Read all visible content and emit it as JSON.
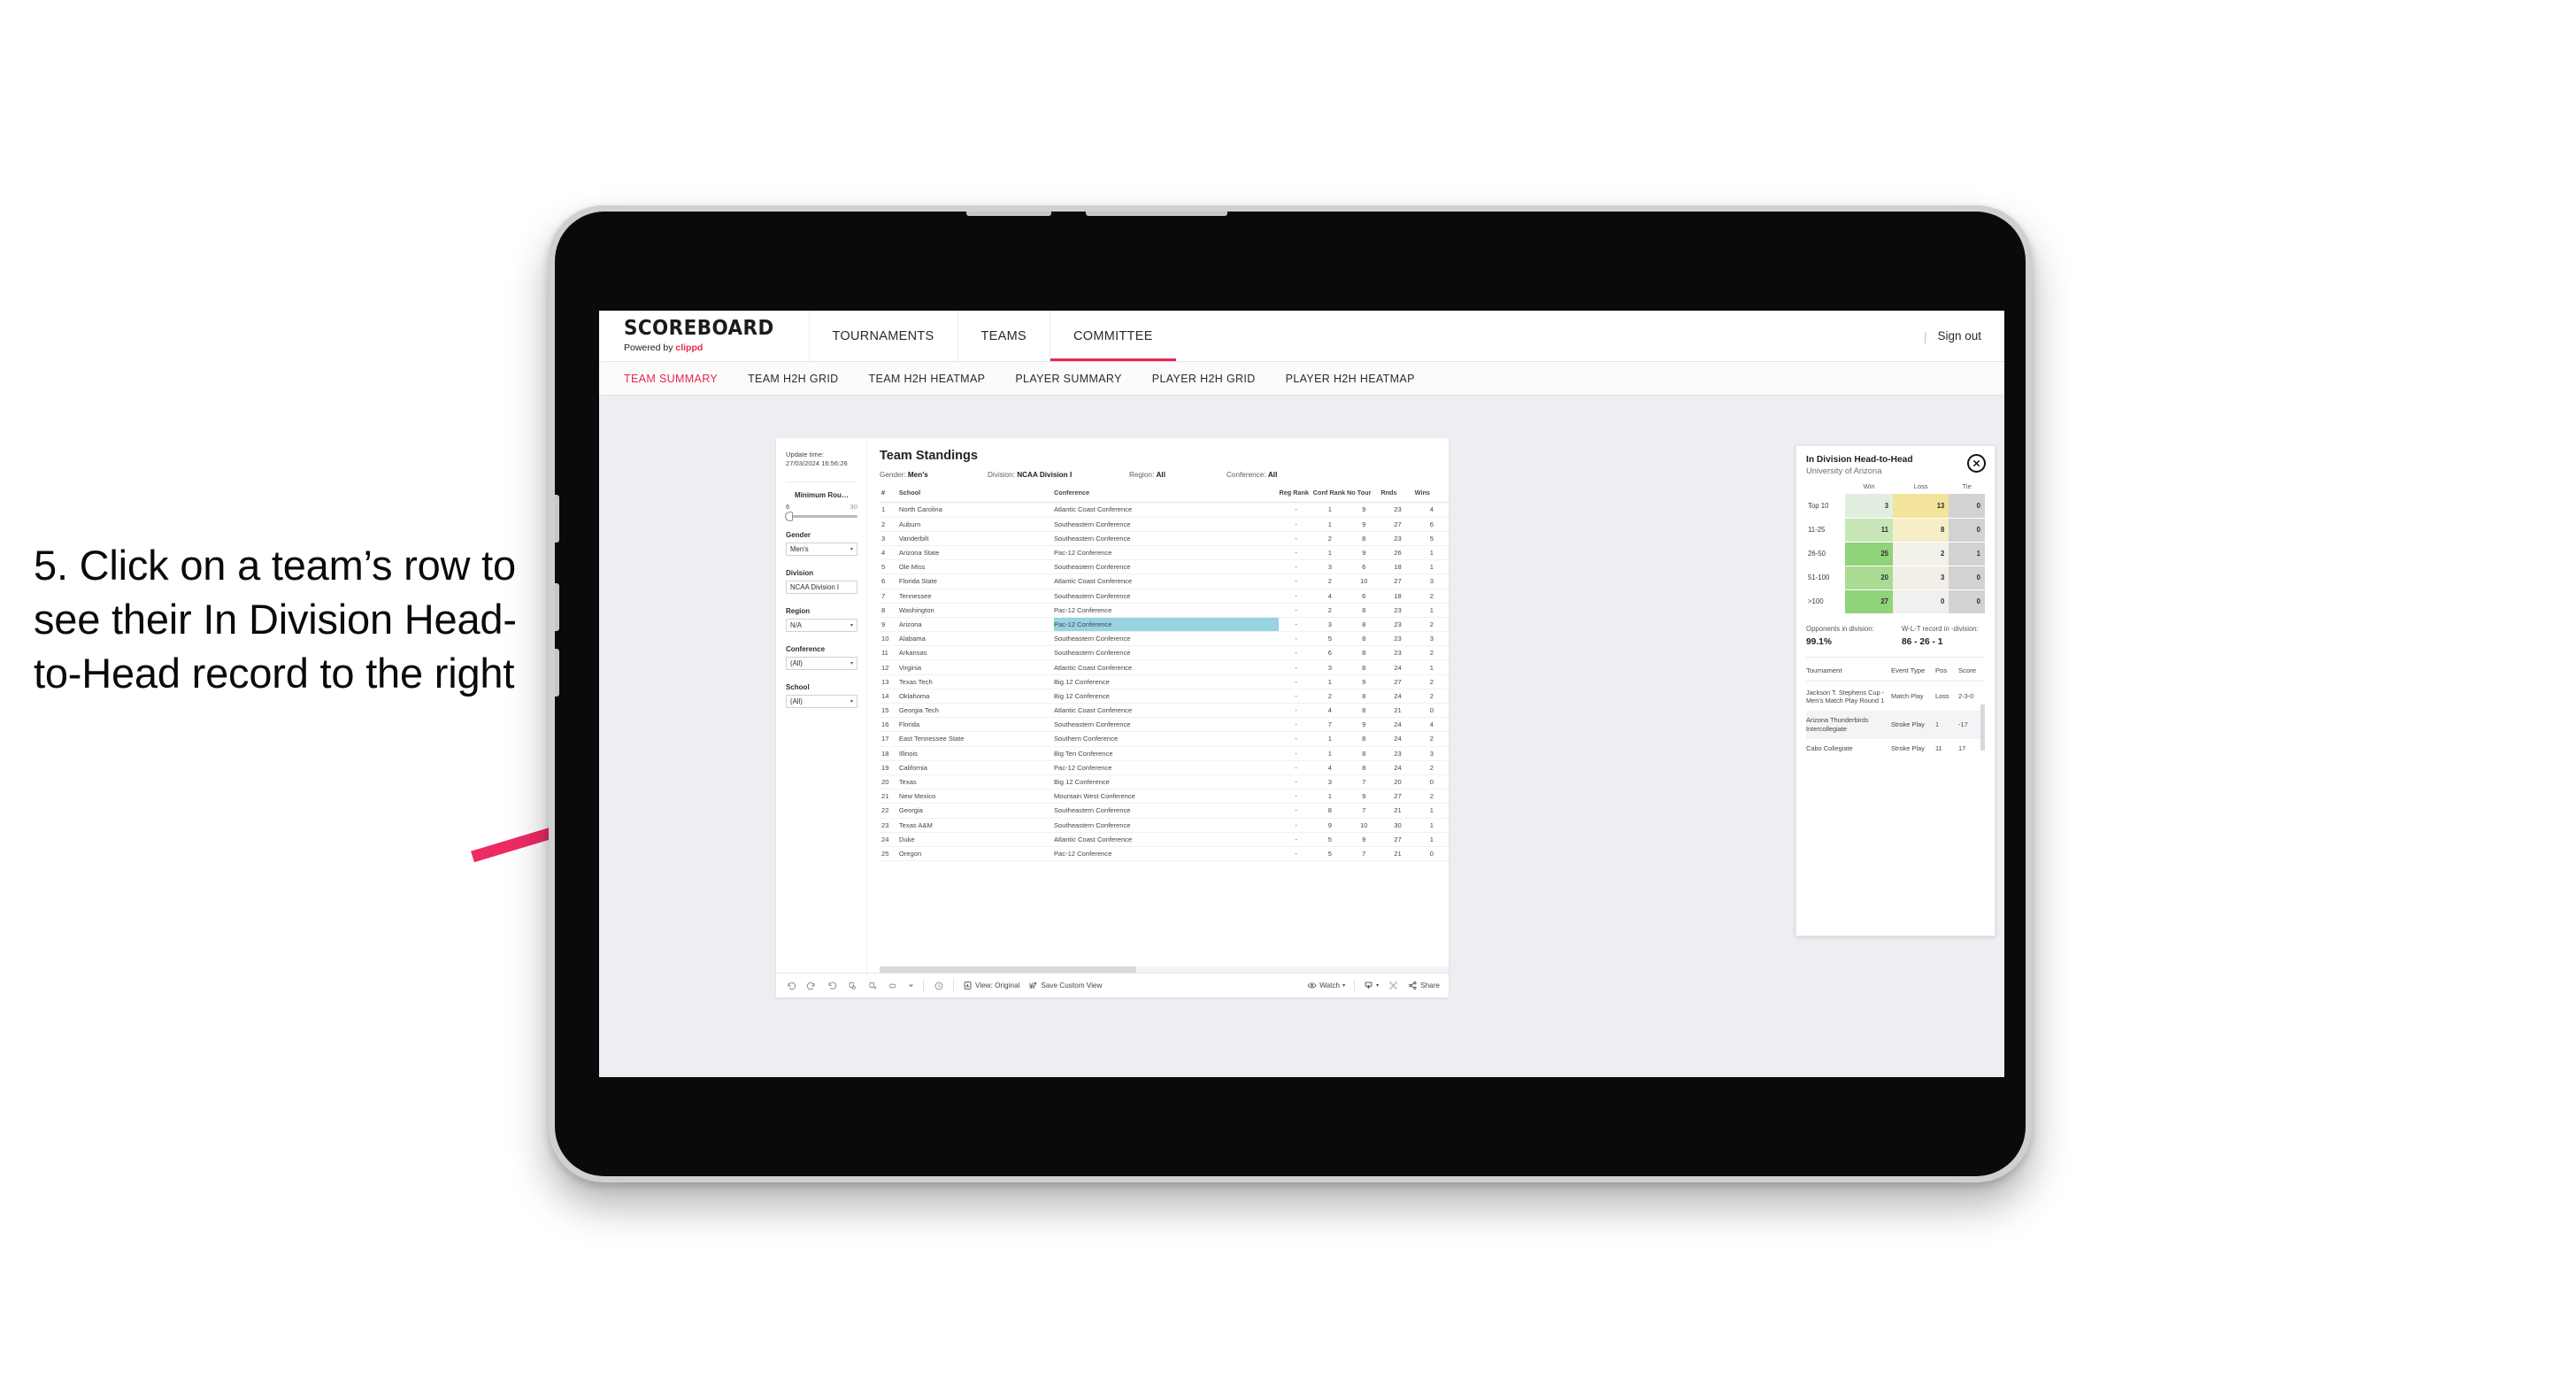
{
  "annotation": {
    "text": "5. Click on a team’s row to see their In Division Head-to-Head record to the right",
    "arrow_color": "#ee2a63"
  },
  "app": {
    "brand": {
      "title": "SCOREBOARD",
      "powered_prefix": "Powered by ",
      "powered_name": "clippd"
    },
    "top_nav": [
      {
        "label": "TOURNAMENTS",
        "active": false
      },
      {
        "label": "TEAMS",
        "active": false
      },
      {
        "label": "COMMITTEE",
        "active": true
      }
    ],
    "sign_out": "Sign out",
    "divider": "|",
    "sub_nav": [
      {
        "label": "TEAM SUMMARY",
        "active": true
      },
      {
        "label": "TEAM H2H GRID",
        "active": false
      },
      {
        "label": "TEAM H2H HEATMAP",
        "active": false
      },
      {
        "label": "PLAYER SUMMARY",
        "active": false
      },
      {
        "label": "PLAYER H2H GRID",
        "active": false
      },
      {
        "label": "PLAYER H2H HEATMAP",
        "active": false
      }
    ],
    "accent": "#e8264f"
  },
  "filters": {
    "update_time_label": "Update time:",
    "update_time_value": "27/03/2024 16:56:26",
    "min_rounds": {
      "label": "Minimum Rou…",
      "min": "6",
      "max": "30"
    },
    "gender": {
      "label": "Gender",
      "value": "Men’s"
    },
    "division": {
      "label": "Division",
      "value": "NCAA Division I"
    },
    "region": {
      "label": "Region",
      "value": "N/A"
    },
    "conference": {
      "label": "Conference",
      "value": "(All)"
    },
    "school": {
      "label": "School",
      "value": "(All)"
    },
    "caret": "▾"
  },
  "standings": {
    "title": "Team Standings",
    "meta": [
      {
        "label": "Gender: ",
        "value": "Men’s"
      },
      {
        "label": "Division: ",
        "value": "NCAA Division I"
      },
      {
        "label": "Region: ",
        "value": "All"
      },
      {
        "label": "Conference: ",
        "value": "All"
      }
    ],
    "columns": [
      "#",
      "School",
      "Conference",
      "Reg Rank",
      "Conf Rank",
      "No Tour",
      "Rnds",
      "Wins"
    ],
    "highlight_color": "#98d3e0",
    "highlighted_row_rank": "9",
    "rows": [
      {
        "rank": "1",
        "school": "North Carolina",
        "conference": "Atlantic Coast Conference",
        "reg_rank": "-",
        "conf_rank": "1",
        "no_tour": "9",
        "rnds": "23",
        "wins": "4"
      },
      {
        "rank": "2",
        "school": "Auburn",
        "conference": "Southeastern Conference",
        "reg_rank": "-",
        "conf_rank": "1",
        "no_tour": "9",
        "rnds": "27",
        "wins": "6"
      },
      {
        "rank": "3",
        "school": "Vanderbilt",
        "conference": "Southeastern Conference",
        "reg_rank": "-",
        "conf_rank": "2",
        "no_tour": "8",
        "rnds": "23",
        "wins": "5"
      },
      {
        "rank": "4",
        "school": "Arizona State",
        "conference": "Pac-12 Conference",
        "reg_rank": "-",
        "conf_rank": "1",
        "no_tour": "9",
        "rnds": "26",
        "wins": "1"
      },
      {
        "rank": "5",
        "school": "Ole Miss",
        "conference": "Southeastern Conference",
        "reg_rank": "-",
        "conf_rank": "3",
        "no_tour": "6",
        "rnds": "18",
        "wins": "1"
      },
      {
        "rank": "6",
        "school": "Florida State",
        "conference": "Atlantic Coast Conference",
        "reg_rank": "-",
        "conf_rank": "2",
        "no_tour": "10",
        "rnds": "27",
        "wins": "3"
      },
      {
        "rank": "7",
        "school": "Tennessee",
        "conference": "Southeastern Conference",
        "reg_rank": "-",
        "conf_rank": "4",
        "no_tour": "6",
        "rnds": "18",
        "wins": "2"
      },
      {
        "rank": "8",
        "school": "Washington",
        "conference": "Pac-12 Conference",
        "reg_rank": "-",
        "conf_rank": "2",
        "no_tour": "8",
        "rnds": "23",
        "wins": "1"
      },
      {
        "rank": "9",
        "school": "Arizona",
        "conference": "Pac-12 Conference",
        "reg_rank": "-",
        "conf_rank": "3",
        "no_tour": "8",
        "rnds": "23",
        "wins": "2"
      },
      {
        "rank": "10",
        "school": "Alabama",
        "conference": "Southeastern Conference",
        "reg_rank": "-",
        "conf_rank": "5",
        "no_tour": "8",
        "rnds": "23",
        "wins": "3"
      },
      {
        "rank": "11",
        "school": "Arkansas",
        "conference": "Southeastern Conference",
        "reg_rank": "-",
        "conf_rank": "6",
        "no_tour": "8",
        "rnds": "23",
        "wins": "2"
      },
      {
        "rank": "12",
        "school": "Virginia",
        "conference": "Atlantic Coast Conference",
        "reg_rank": "-",
        "conf_rank": "3",
        "no_tour": "8",
        "rnds": "24",
        "wins": "1"
      },
      {
        "rank": "13",
        "school": "Texas Tech",
        "conference": "Big 12 Conference",
        "reg_rank": "-",
        "conf_rank": "1",
        "no_tour": "9",
        "rnds": "27",
        "wins": "2"
      },
      {
        "rank": "14",
        "school": "Oklahoma",
        "conference": "Big 12 Conference",
        "reg_rank": "-",
        "conf_rank": "2",
        "no_tour": "8",
        "rnds": "24",
        "wins": "2"
      },
      {
        "rank": "15",
        "school": "Georgia Tech",
        "conference": "Atlantic Coast Conference",
        "reg_rank": "-",
        "conf_rank": "4",
        "no_tour": "8",
        "rnds": "21",
        "wins": "0"
      },
      {
        "rank": "16",
        "school": "Florida",
        "conference": "Southeastern Conference",
        "reg_rank": "-",
        "conf_rank": "7",
        "no_tour": "9",
        "rnds": "24",
        "wins": "4"
      },
      {
        "rank": "17",
        "school": "East Tennessee State",
        "conference": "Southern Conference",
        "reg_rank": "-",
        "conf_rank": "1",
        "no_tour": "8",
        "rnds": "24",
        "wins": "2"
      },
      {
        "rank": "18",
        "school": "Illinois",
        "conference": "Big Ten Conference",
        "reg_rank": "-",
        "conf_rank": "1",
        "no_tour": "8",
        "rnds": "23",
        "wins": "3"
      },
      {
        "rank": "19",
        "school": "California",
        "conference": "Pac-12 Conference",
        "reg_rank": "-",
        "conf_rank": "4",
        "no_tour": "8",
        "rnds": "24",
        "wins": "2"
      },
      {
        "rank": "20",
        "school": "Texas",
        "conference": "Big 12 Conference",
        "reg_rank": "-",
        "conf_rank": "3",
        "no_tour": "7",
        "rnds": "20",
        "wins": "0"
      },
      {
        "rank": "21",
        "school": "New Mexico",
        "conference": "Mountain West Conference",
        "reg_rank": "-",
        "conf_rank": "1",
        "no_tour": "9",
        "rnds": "27",
        "wins": "2"
      },
      {
        "rank": "22",
        "school": "Georgia",
        "conference": "Southeastern Conference",
        "reg_rank": "-",
        "conf_rank": "8",
        "no_tour": "7",
        "rnds": "21",
        "wins": "1"
      },
      {
        "rank": "23",
        "school": "Texas A&M",
        "conference": "Southeastern Conference",
        "reg_rank": "-",
        "conf_rank": "9",
        "no_tour": "10",
        "rnds": "30",
        "wins": "1"
      },
      {
        "rank": "24",
        "school": "Duke",
        "conference": "Atlantic Coast Conference",
        "reg_rank": "-",
        "conf_rank": "5",
        "no_tour": "9",
        "rnds": "27",
        "wins": "1"
      },
      {
        "rank": "25",
        "school": "Oregon",
        "conference": "Pac-12 Conference",
        "reg_rank": "-",
        "conf_rank": "5",
        "no_tour": "7",
        "rnds": "21",
        "wins": "0"
      }
    ]
  },
  "h2h": {
    "title": "In Division Head-to-Head",
    "subtitle": "University of Arizona",
    "close_label": "✕",
    "columns": [
      "",
      "Win",
      "Loss",
      "Tie"
    ],
    "rows": [
      {
        "bucket": "Top 10",
        "win": "3",
        "loss": "13",
        "tie": "0",
        "win_color": "#e2efe0",
        "loss_color": "#f2e49a",
        "tie_color": "#d2d2d2"
      },
      {
        "bucket": "11-25",
        "win": "11",
        "loss": "8",
        "tie": "0",
        "win_color": "#c8e6b8",
        "loss_color": "#f6eec6",
        "tie_color": "#d2d2d2"
      },
      {
        "bucket": "26-50",
        "win": "25",
        "loss": "2",
        "tie": "1",
        "win_color": "#8fd37a",
        "loss_color": "#f2f1ea",
        "tie_color": "#d2d2d2"
      },
      {
        "bucket": "51-100",
        "win": "20",
        "loss": "3",
        "tie": "0",
        "win_color": "#a9dc92",
        "loss_color": "#f2efe6",
        "tie_color": "#d2d2d2"
      },
      {
        "bucket": ">100",
        "win": "27",
        "loss": "0",
        "tie": "0",
        "win_color": "#8fd37a",
        "loss_color": "#f0f0ee",
        "tie_color": "#d2d2d2"
      }
    ],
    "stats": {
      "opponents_label": "Opponents in division:",
      "opponents_value": "99.1%",
      "record_label": "W-L-T record in -division:",
      "record_value": "86 - 26 - 1"
    },
    "tournaments_columns": [
      "Tournament",
      "Event Type",
      "Pos",
      "Score"
    ],
    "tournaments": [
      {
        "name": "Jackson T. Stephens Cup - Men’s Match Play Round 1",
        "type": "Match Play",
        "pos": "Loss",
        "score": "2-3-0"
      },
      {
        "name": "Arizona Thunderbirds Intercollegiate",
        "type": "Stroke Play",
        "pos": "1",
        "score": "-17"
      },
      {
        "name": "Cabo Collegiate",
        "type": "Stroke Play",
        "pos": "11",
        "score": "17"
      }
    ]
  },
  "toolbar": {
    "icons": [
      "undo-icon",
      "redo-icon",
      "revert-icon",
      "refresh-data-icon",
      "pause-updates-icon",
      "highlight-icon",
      "caret-down-icon"
    ],
    "clock_icon": "clock-icon",
    "view_label": "View: Original",
    "save_label": "Save Custom View",
    "watch_label": "Watch",
    "share_label": "Share",
    "caret": "▾"
  }
}
